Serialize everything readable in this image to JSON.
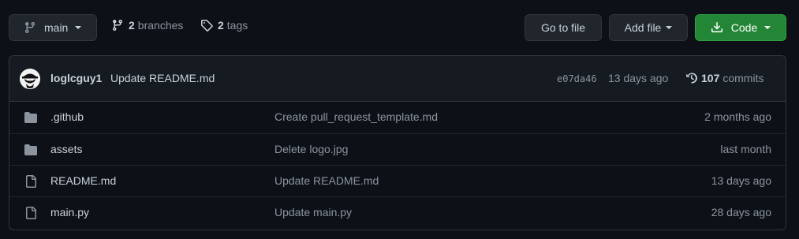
{
  "toolbar": {
    "branch_name": "main",
    "branches_count": "2",
    "branches_label": "branches",
    "tags_count": "2",
    "tags_label": "tags",
    "go_to_file": "Go to file",
    "add_file": "Add file",
    "code": "Code"
  },
  "commit": {
    "author": "loglcguy1",
    "message": "Update README.md",
    "sha": "e07da46",
    "when": "13 days ago",
    "commits_count": "107",
    "commits_label": "commits"
  },
  "files": [
    {
      "type": "folder",
      "icon": "folder-icon",
      "name": ".github",
      "message": "Create pull_request_template.md",
      "age": "2 months ago"
    },
    {
      "type": "folder",
      "icon": "folder-icon",
      "name": "assets",
      "message": "Delete logo.jpg",
      "age": "last month"
    },
    {
      "type": "file",
      "icon": "file-icon",
      "name": "README.md",
      "message": "Update README.md",
      "age": "13 days ago"
    },
    {
      "type": "file",
      "icon": "file-icon",
      "name": "main.py",
      "message": "Update main.py",
      "age": "28 days ago"
    }
  ],
  "colors": {
    "background": "#0d1117",
    "code_button": "#238636",
    "muted": "#8b949e"
  }
}
